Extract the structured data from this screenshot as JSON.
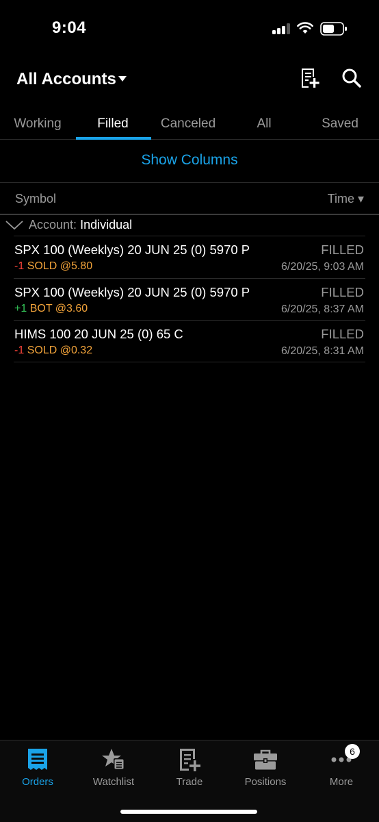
{
  "status_bar": {
    "time": "9:04"
  },
  "header": {
    "title": "All Accounts"
  },
  "tabs": [
    {
      "label": "Working",
      "active": false
    },
    {
      "label": "Filled",
      "active": true
    },
    {
      "label": "Canceled",
      "active": false
    },
    {
      "label": "All",
      "active": false
    },
    {
      "label": "Saved",
      "active": false
    }
  ],
  "show_columns_label": "Show Columns",
  "columns": {
    "symbol": "Symbol",
    "time": "Time ▾"
  },
  "group": {
    "label": "Account:",
    "value": "Individual"
  },
  "orders": [
    {
      "symbol": "SPX 100 (Weeklys) 20 JUN 25 (0) 5970 P",
      "status": "FILLED",
      "qty": "-1",
      "action": "SOLD @5.80",
      "time": "6/20/25, 9:03 AM"
    },
    {
      "symbol": "SPX 100 (Weeklys) 20 JUN 25 (0) 5970 P",
      "status": "FILLED",
      "qty": "+1",
      "action": "BOT @3.60",
      "time": "6/20/25, 8:37 AM"
    },
    {
      "symbol": "HIMS 100 20 JUN 25 (0) 65 C",
      "status": "FILLED",
      "qty": "-1",
      "action": "SOLD @0.32",
      "time": "6/20/25, 8:31 AM"
    }
  ],
  "bottom_nav": [
    {
      "label": "Orders",
      "icon": "orders-icon",
      "active": true
    },
    {
      "label": "Watchlist",
      "icon": "watchlist-icon",
      "active": false
    },
    {
      "label": "Trade",
      "icon": "trade-icon",
      "active": false
    },
    {
      "label": "Positions",
      "icon": "positions-icon",
      "active": false
    },
    {
      "label": "More",
      "icon": "more-icon",
      "active": false
    }
  ],
  "more_badge": "6",
  "colors": {
    "accent": "#1aa3e8",
    "negative": "#ff453a",
    "positive": "#34c759",
    "action": "#f2a33a"
  }
}
